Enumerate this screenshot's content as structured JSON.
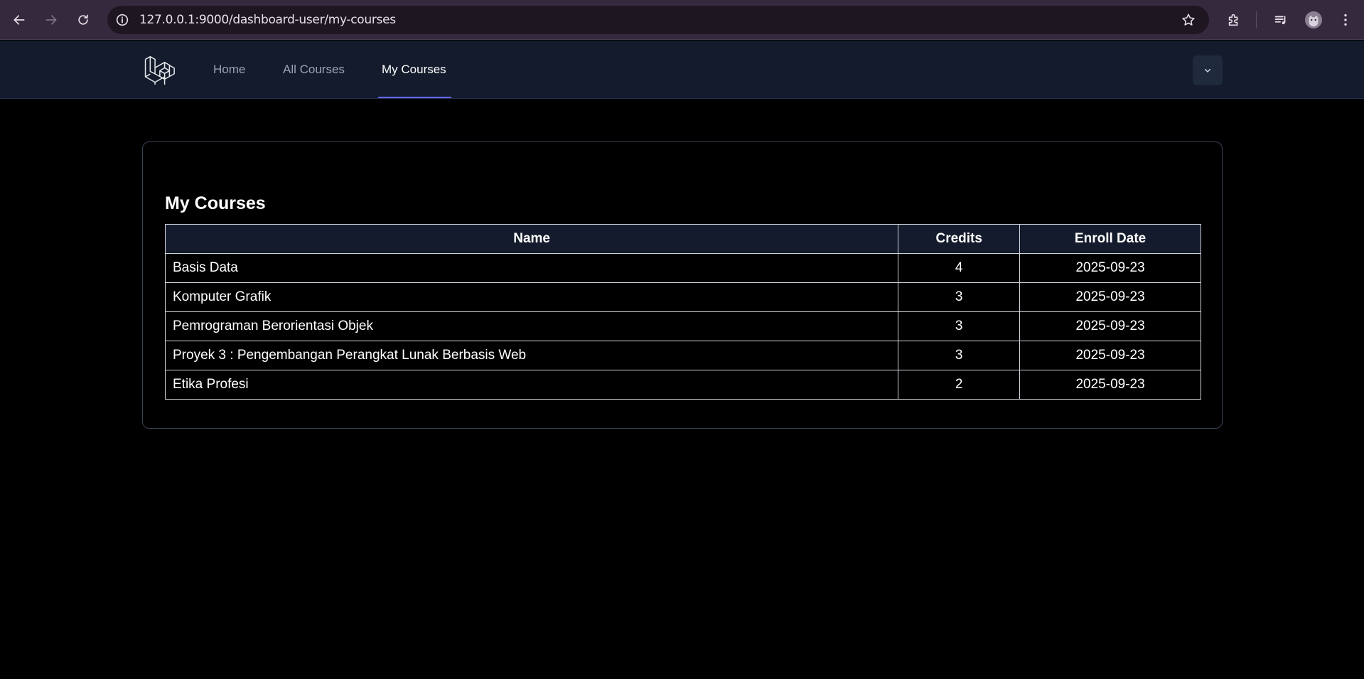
{
  "browser": {
    "url": "127.0.0.1:9000/dashboard-user/my-courses"
  },
  "navbar": {
    "links": [
      {
        "label": "Home"
      },
      {
        "label": "All Courses"
      },
      {
        "label": "My Courses"
      }
    ],
    "active": "My Courses"
  },
  "page": {
    "title": "My Courses"
  },
  "table": {
    "headers": [
      "Name",
      "Credits",
      "Enroll Date"
    ],
    "rows": [
      {
        "name": "Basis Data",
        "credits": "4",
        "enroll_date": "2025-09-23"
      },
      {
        "name": "Komputer Grafik",
        "credits": "3",
        "enroll_date": "2025-09-23"
      },
      {
        "name": "Pemrograman Berorientasi Objek",
        "credits": "3",
        "enroll_date": "2025-09-23"
      },
      {
        "name": "Proyek 3 : Pengembangan Perangkat Lunak Berbasis Web",
        "credits": "3",
        "enroll_date": "2025-09-23"
      },
      {
        "name": "Etika Profesi",
        "credits": "2",
        "enroll_date": "2025-09-23"
      }
    ]
  },
  "colors": {
    "accent": "#6366f1",
    "navbar_bg": "#141b2c",
    "browser_bg": "#35293d"
  }
}
